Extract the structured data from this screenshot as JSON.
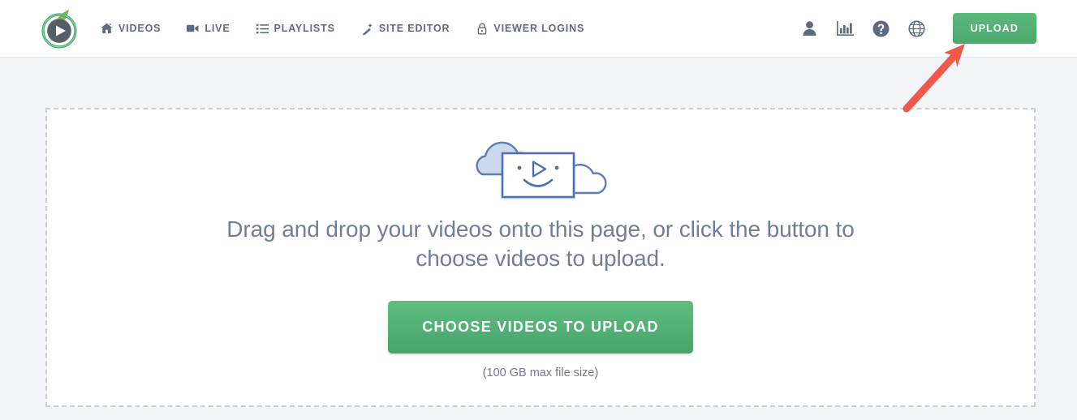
{
  "header": {
    "logo_name": "play-leaf-logo",
    "nav": [
      {
        "label": "VIDEOS",
        "icon": "home-icon"
      },
      {
        "label": "LIVE",
        "icon": "video-camera-icon"
      },
      {
        "label": "PLAYLISTS",
        "icon": "list-icon"
      },
      {
        "label": "SITE EDITOR",
        "icon": "magic-wand-icon"
      },
      {
        "label": "VIEWER LOGINS",
        "icon": "lock-icon"
      }
    ],
    "utilities": [
      {
        "name": "account-icon"
      },
      {
        "name": "analytics-icon"
      },
      {
        "name": "help-icon"
      },
      {
        "name": "globe-icon"
      }
    ],
    "upload_label": "UPLOAD"
  },
  "dropzone": {
    "illustration_name": "video-screen-with-clouds-illustration",
    "prompt": "Drag and drop your videos onto this page, or click the button to choose videos to upload.",
    "choose_label": "CHOOSE VIDEOS TO UPLOAD",
    "max_size_note": "(100 GB max file size)"
  },
  "annotation": {
    "arrow_name": "red-arrow-pointing-to-upload-button",
    "color": "#f0594a"
  },
  "colors": {
    "page_background": "#f2f4f8",
    "header_background": "#ffffff",
    "accent_green": "#4aa96d",
    "text_muted": "#6f7e99",
    "nav_text": "#5d6b82",
    "dropzone_border": "#c9ccd4",
    "illustration_outline": "#5b7cb5",
    "illustration_fill": "#ccd9ec",
    "annotation_red": "#f0594a"
  }
}
